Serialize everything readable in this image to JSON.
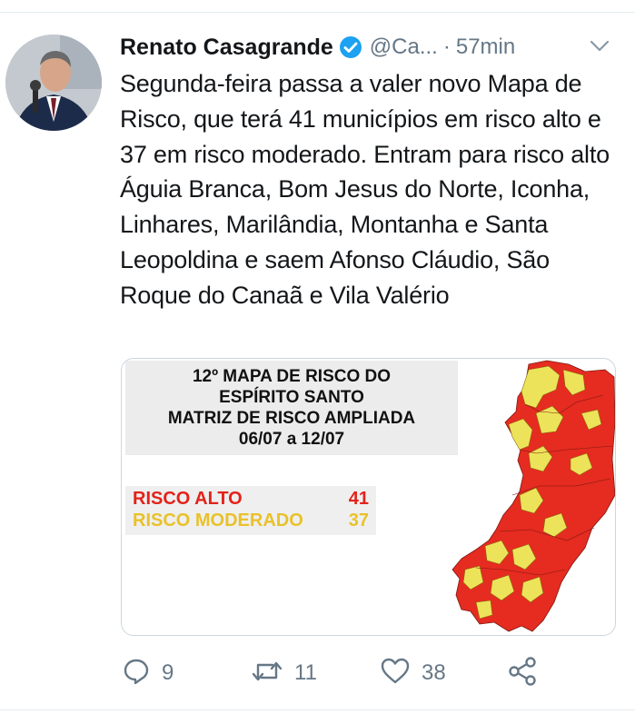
{
  "tweet": {
    "author_name": "Renato Casagrande",
    "handle": "@Ca...",
    "separator": "·",
    "time": "57min",
    "text": "Segunda-feira passa a valer novo Mapa de Risco, que terá 41 municípios em risco alto e 37 em risco moderado. Entram para risco alto Águia Branca, Bom Jesus do Norte, Iconha, Linhares, Marilândia, Montanha e Santa Leopoldina e saem Afonso Cláudio, São Roque do Canaã e Vila Valério"
  },
  "media": {
    "title_lines": [
      "12º MAPA DE RISCO DO",
      "ESPÍRITO SANTO",
      "MATRIZ DE RISCO AMPLIADA",
      "06/07 a 12/07"
    ],
    "legend": [
      {
        "label": "RISCO ALTO",
        "value": "41",
        "color": "#e2231a"
      },
      {
        "label": "RISCO MODERADO",
        "value": "37",
        "color": "#e9c22a"
      }
    ]
  },
  "actions": {
    "replies": "9",
    "retweets": "11",
    "likes": "38"
  },
  "colors": {
    "verified": "#1da1f2",
    "icon_gray": "#657786",
    "risk_high": "#e2231a",
    "risk_moderate": "#ede35a"
  },
  "icons": [
    "verified-badge-icon",
    "chevron-down-icon",
    "reply-icon",
    "retweet-icon",
    "like-icon",
    "share-icon"
  ]
}
